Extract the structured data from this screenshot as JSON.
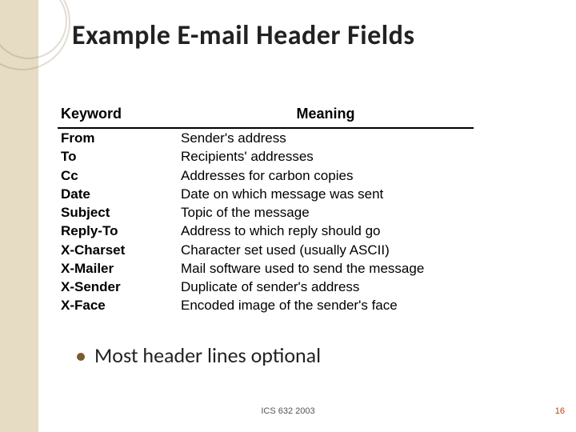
{
  "slide": {
    "title": "Example E-mail Header Fields",
    "bullet": "Most header lines optional",
    "footer": "ICS 632 2003",
    "page_number": "16"
  },
  "table": {
    "headers": {
      "keyword": "Keyword",
      "meaning": "Meaning"
    },
    "rows": [
      {
        "keyword": "From",
        "meaning": "Sender's address"
      },
      {
        "keyword": "To",
        "meaning": "Recipients' addresses"
      },
      {
        "keyword": "Cc",
        "meaning": "Addresses for carbon copies"
      },
      {
        "keyword": "Date",
        "meaning": "Date on which message was sent"
      },
      {
        "keyword": "Subject",
        "meaning": "Topic of the message"
      },
      {
        "keyword": "Reply-To",
        "meaning": "Address to which reply should go"
      },
      {
        "keyword": "X-Charset",
        "meaning": "Character set used (usually ASCII)"
      },
      {
        "keyword": "X-Mailer",
        "meaning": "Mail software used to send the message"
      },
      {
        "keyword": "X-Sender",
        "meaning": "Duplicate of sender's address"
      },
      {
        "keyword": "X-Face",
        "meaning": "Encoded image of the sender's face"
      }
    ]
  }
}
